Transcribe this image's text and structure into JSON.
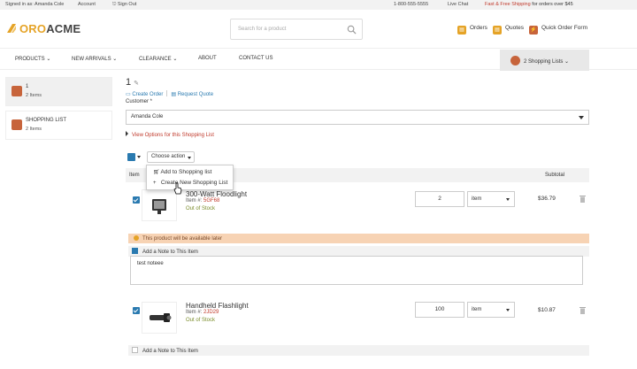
{
  "topbar": {
    "signed_in": "Signed in as: Amanda Cole",
    "account": "Account",
    "sign_out": "Sign Out",
    "phone": "1-800-555-5555",
    "live_chat": "Live Chat",
    "promo_highlight": "Fast & Free Shipping",
    "promo_rest": "for orders over $45"
  },
  "header": {
    "logo_oro": "ORO",
    "logo_acme": "ACME",
    "search_placeholder": "Search for a product",
    "orders": "Orders",
    "quotes": "Quotes",
    "quick_order": "Quick Order Form"
  },
  "nav": {
    "items": [
      "PRODUCTS",
      "NEW ARRIVALS",
      "CLEARANCE",
      "ABOUT",
      "CONTACT US"
    ],
    "shopping_lists": "2 Shopping Lists"
  },
  "sidebar": {
    "lists": [
      {
        "name": "1",
        "count": "2 Items"
      },
      {
        "name": "SHOPPING LIST",
        "count": "2 Items"
      }
    ]
  },
  "main": {
    "list_name": "1",
    "create_order": "Create Order",
    "request_quote": "Request Quote",
    "customer_label": "Customer *",
    "customer_value": "Amanda Cole",
    "view_options": "View Options for this Shopping List",
    "choose_action": "Choose action",
    "dropdown": [
      "Add to Shopping list",
      "Create New Shopping List"
    ],
    "col_item": "Item",
    "col_subtotal": "Subtotal",
    "warning": "This product will be available later",
    "add_note": "Add a Note to This Item",
    "items": [
      {
        "name": "300-Watt Floodlight",
        "item_prefix": "Item #:",
        "sku": "5GF68",
        "stock": "Out of Stock",
        "qty": "2",
        "unit": "item",
        "subtotal": "$36.79",
        "note": "test noteee"
      },
      {
        "name": "Handheld Flashlight",
        "item_prefix": "Item #:",
        "sku": "2JD29",
        "stock": "Out of Stock",
        "qty": "100",
        "unit": "item",
        "subtotal": "$10.87"
      }
    ]
  },
  "colors": {
    "accent": "#e5a326",
    "link": "#2a7ab0",
    "danger": "#c0392b",
    "bag": "#c7643b",
    "warning_bg": "#f7d3b4"
  }
}
